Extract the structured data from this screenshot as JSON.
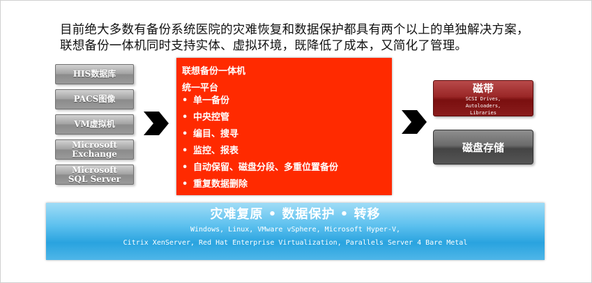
{
  "intro": {
    "line1": "目前绝大多数有备份系统医院的灾难恢复和数据保护都具有两个以上的单独解决方案，",
    "line2": "联想备份一体机同时支持实体、虚拟环境，既降低了成本，又简化了管理。"
  },
  "sources": [
    {
      "line1": "HIS数据库",
      "line2": ""
    },
    {
      "line1": "PACS图像",
      "line2": ""
    },
    {
      "line1": "VM虚拟机",
      "line2": ""
    },
    {
      "line1": "Microsoft",
      "line2": "Exchange"
    },
    {
      "line1": "Microsoft",
      "line2": "SQL Server"
    }
  ],
  "center": {
    "title": "联想备份一体机",
    "subtitle": "统一平台",
    "bullet": "•",
    "items": [
      "单一备份",
      "中央控管",
      "编目、搜寻",
      "监控、报表",
      "自动保留、磁盘分段、多重位置备份",
      "重复数据删除"
    ]
  },
  "tape": {
    "title": "磁带",
    "sub1": "SCSI Drives,",
    "sub2": "Autoloaders,",
    "sub3": "Libraries"
  },
  "disk": {
    "title": "磁盘存储"
  },
  "bottom": {
    "title": "灾难复原 • 数据保护 • 转移",
    "line1": "Windows, Linux, VMware vSphere, Microsoft Hyper-V,",
    "line2": "Citrix XenServer, Red Hat Enterprise Virtualization, Parallels Server 4 Bare Metal"
  },
  "colors": {
    "center_bg": "#ff2a00",
    "tape_bg": "#8a1c1c",
    "bottom_bg": "#29a3df"
  },
  "icons": [
    "arrow-right-icon",
    "arrow-right-icon"
  ]
}
